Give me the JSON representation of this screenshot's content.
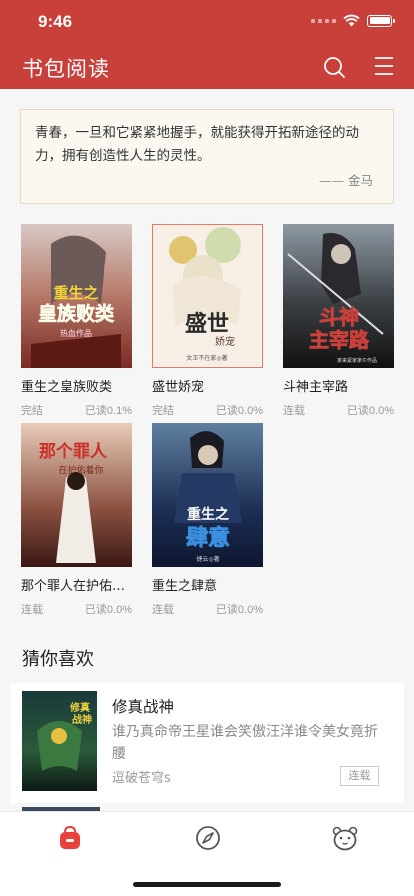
{
  "status": {
    "time": "9:46"
  },
  "header": {
    "title": "书包阅读",
    "search_icon": "search-icon",
    "menu_icon": "menu-icon"
  },
  "colors": {
    "brand": "#c9403a",
    "accent_red": "#e8413c"
  },
  "quote": {
    "text": "青春，一旦和它紧紧地握手，就能获得开拓新途径的动力，拥有创造性人生的灵性。",
    "author": "—— 金马"
  },
  "shelf": [
    {
      "title": "重生之皇族败类",
      "status": "完结",
      "progress": "已读0.1%",
      "cover_text": "重生之皇族败类",
      "cover_sub": "热血作品"
    },
    {
      "title": "盛世娇宠",
      "status": "完结",
      "progress": "已读0.0%",
      "cover_text": "盛世",
      "cover_text2": "娇宠",
      "cover_sub": "女王不在家◎著"
    },
    {
      "title": "斗神主宰路",
      "status": "连载",
      "progress": "已读0.0%",
      "cover_text": "斗神主宰路",
      "cover_sub": "家来紧家家©作品"
    },
    {
      "title": "那个罪人在护佑…",
      "status": "连载",
      "progress": "已读0.0%",
      "cover_text": "那个罪人",
      "cover_sub": "在护佑着你"
    },
    {
      "title": "重生之肆意",
      "status": "连载",
      "progress": "已读0.0%",
      "cover_text": "重生之",
      "cover_text2": "肆意",
      "cover_sub": "捷云◎著"
    }
  ],
  "guess": {
    "section_title": "猜你喜欢",
    "item": {
      "title": "修真战神",
      "description": "谁乃真命帝王星谁会笑傲汪洋谁令美女竟折腰",
      "author": "逗破苍穹s",
      "status": "连载",
      "cover_text": "修真战神"
    }
  },
  "tabbar": [
    {
      "icon": "bookshelf-bag-icon",
      "active": true
    },
    {
      "icon": "compass-icon",
      "active": false
    },
    {
      "icon": "profile-bear-icon",
      "active": false
    }
  ]
}
